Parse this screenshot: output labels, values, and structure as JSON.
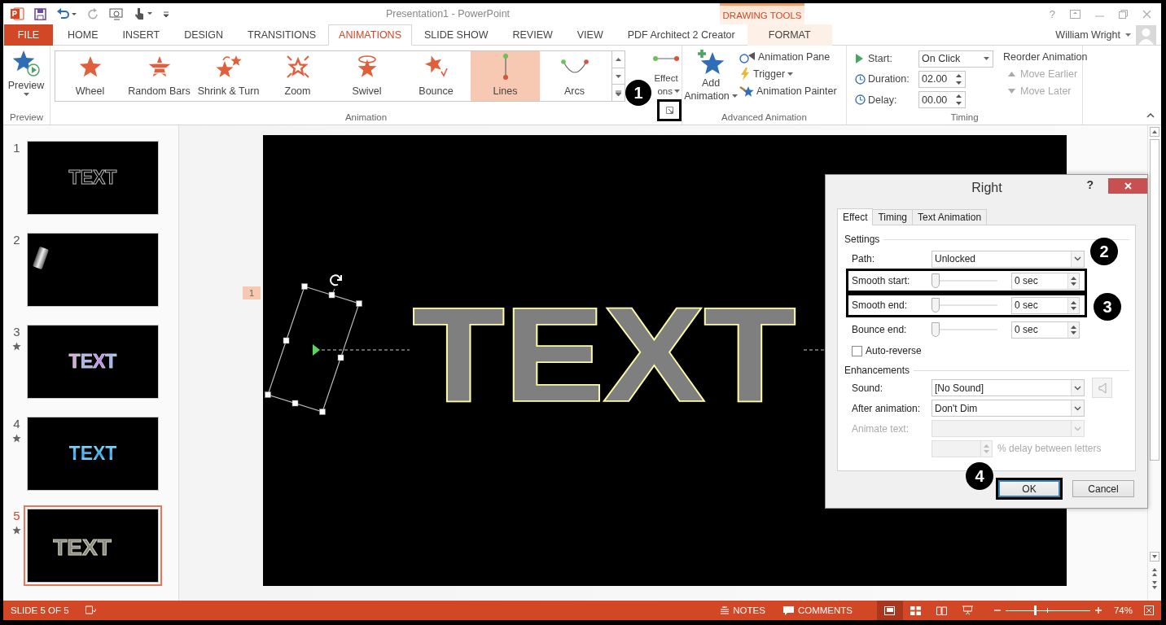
{
  "window": {
    "title": "Presentation1 - PowerPoint",
    "contextual_group": "DRAWING TOOLS",
    "help": "?"
  },
  "tabs": [
    {
      "label": "FILE",
      "kind": "file",
      "selected": false
    },
    {
      "label": "HOME",
      "kind": "normal",
      "selected": false
    },
    {
      "label": "INSERT",
      "kind": "normal",
      "selected": false
    },
    {
      "label": "DESIGN",
      "kind": "normal",
      "selected": false
    },
    {
      "label": "TRANSITIONS",
      "kind": "normal",
      "selected": false
    },
    {
      "label": "ANIMATIONS",
      "kind": "normal",
      "selected": true
    },
    {
      "label": "SLIDE SHOW",
      "kind": "normal",
      "selected": false
    },
    {
      "label": "REVIEW",
      "kind": "normal",
      "selected": false
    },
    {
      "label": "VIEW",
      "kind": "normal",
      "selected": false
    },
    {
      "label": "PDF Architect 2 Creator",
      "kind": "normal",
      "selected": false
    },
    {
      "label": "FORMAT",
      "kind": "contextual",
      "selected": false
    }
  ],
  "account": {
    "name": "William Wright"
  },
  "ribbon": {
    "preview": {
      "label": "Preview",
      "group_label": "Preview"
    },
    "animations": [
      {
        "label": "Wheel",
        "kind": "wheel",
        "selected": false
      },
      {
        "label": "Random Bars",
        "kind": "random_bars",
        "selected": false
      },
      {
        "label": "Shrink & Turn",
        "kind": "shrink_turn",
        "selected": false
      },
      {
        "label": "Zoom",
        "kind": "zoom",
        "selected": false
      },
      {
        "label": "Swivel",
        "kind": "swivel",
        "selected": false
      },
      {
        "label": "Bounce",
        "kind": "bounce",
        "selected": false
      },
      {
        "label": "Lines",
        "kind": "lines",
        "selected": true
      },
      {
        "label": "Arcs",
        "kind": "arcs",
        "selected": false
      }
    ],
    "animation_group_label": "Animation",
    "effect_options": {
      "label": "Effect",
      "label_rest": "ons"
    },
    "launcher": {
      "highlighted": true,
      "callout": "1"
    },
    "advanced": {
      "add_animation": [
        "Add",
        "Animation"
      ],
      "items": [
        {
          "label": "Animation Pane",
          "kind": "pane"
        },
        {
          "label": "Trigger",
          "kind": "trigger"
        },
        {
          "label": "Animation Painter",
          "kind": "painter"
        }
      ],
      "group_label": "Advanced Animation"
    },
    "timing": {
      "fields": [
        {
          "label": "Start:",
          "value": "On Click",
          "kind": "dropdown"
        },
        {
          "label": "Duration:",
          "value": "02.00",
          "kind": "spinner"
        },
        {
          "label": "Delay:",
          "value": "00.00",
          "kind": "spinner"
        }
      ],
      "reorder_title": "Reorder Animation",
      "reorder": [
        {
          "label": "Move Earlier",
          "kind": "up",
          "disabled": true
        },
        {
          "label": "Move Later",
          "kind": "down",
          "disabled": true
        }
      ],
      "group_label": "Timing"
    }
  },
  "slides": [
    {
      "number": "1",
      "animated": false,
      "selected": false,
      "kind": "outline",
      "text": "TEXT"
    },
    {
      "number": "2",
      "animated": false,
      "selected": false,
      "kind": "shape"
    },
    {
      "number": "3",
      "animated": true,
      "selected": false,
      "kind": "rainbow",
      "text": "TEXT"
    },
    {
      "number": "4",
      "animated": true,
      "selected": false,
      "kind": "blue",
      "text": "TEXT"
    },
    {
      "number": "5",
      "animated": true,
      "selected": true,
      "kind": "gray",
      "text": "TEXT"
    }
  ],
  "editor": {
    "slide_text": "TEXT",
    "animation_tag": "1"
  },
  "dialog": {
    "title": "Right",
    "help": "?",
    "tabs": [
      {
        "label": "Effect",
        "selected": true
      },
      {
        "label": "Timing",
        "selected": false
      },
      {
        "label": "Text Animation",
        "selected": false
      }
    ],
    "settings_label": "Settings",
    "path": {
      "label": "Path:",
      "value": "Unlocked"
    },
    "sliders": [
      {
        "label": "Smooth start:",
        "level": 0,
        "value": "0 sec",
        "highlighted": true,
        "callout": "2"
      },
      {
        "label": "Smooth end:",
        "level": 0,
        "value": "0 sec",
        "highlighted": true,
        "callout": "3"
      },
      {
        "label": "Bounce end:",
        "level": 0,
        "value": "0 sec",
        "highlighted": false
      }
    ],
    "auto_reverse": {
      "label": "Auto-reverse",
      "checked": false
    },
    "enhancements_label": "Enhancements",
    "dropdowns": [
      {
        "label": "Sound:",
        "value": "[No Sound]",
        "kind": "sound",
        "disabled": false
      },
      {
        "label": "After animation:",
        "value": "Don't Dim",
        "kind": "plain",
        "disabled": false
      },
      {
        "label": "Animate text:",
        "kind": "plain",
        "disabled": true
      }
    ],
    "delay_label": "% delay between letters",
    "delay_disabled": true,
    "buttons": [
      {
        "label": "OK",
        "highlighted": true,
        "callout": "4"
      },
      {
        "label": "Cancel",
        "highlighted": false
      }
    ]
  },
  "status_bar": {
    "slide_info": "SLIDE 5 OF 5",
    "notes": "NOTES",
    "comments": "COMMENTS",
    "views": [
      {
        "kind": "normal",
        "selected": true
      },
      {
        "kind": "sorter",
        "selected": false
      },
      {
        "kind": "reading",
        "selected": false
      },
      {
        "kind": "slideshow",
        "selected": false
      }
    ],
    "zoom_slider": {
      "level": 0.35
    },
    "zoom": "74%"
  }
}
